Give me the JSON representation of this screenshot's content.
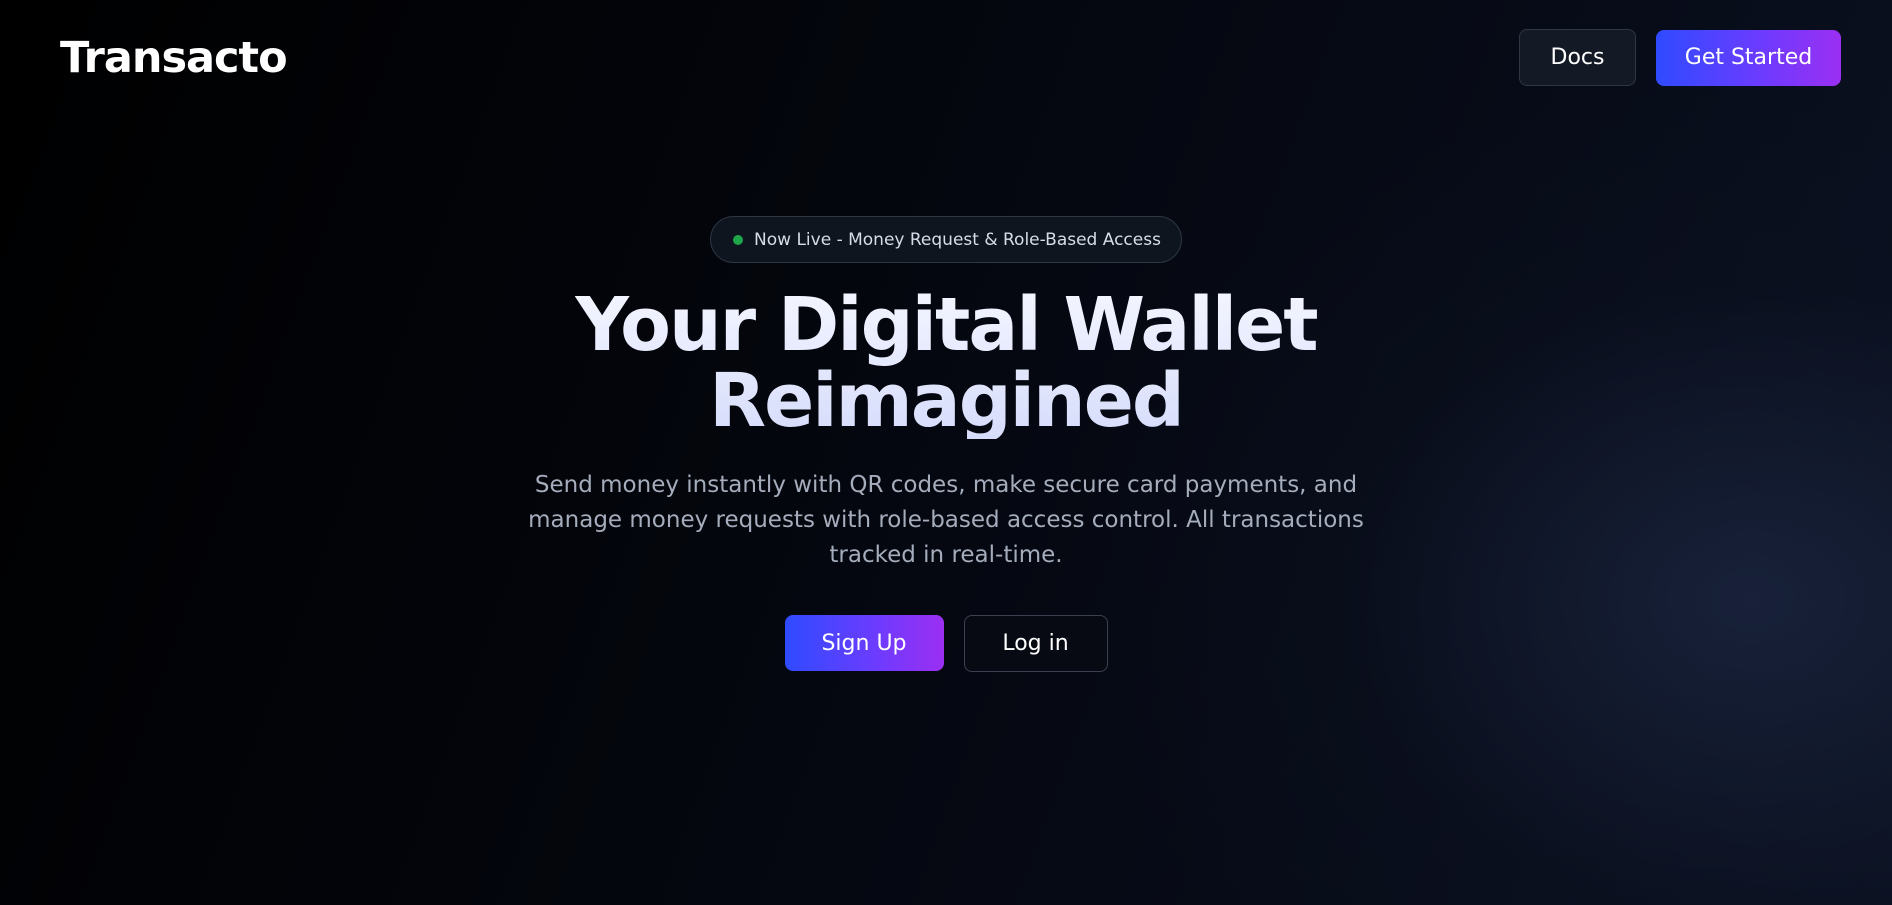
{
  "header": {
    "logo_text": "Transacto",
    "docs_label": "Docs",
    "get_started_label": "Get Started"
  },
  "hero": {
    "badge_text": "Now Live - Money Request & Role-Based Access",
    "headline_line1": "Your Digital Wallet",
    "headline_line2": "Reimagined",
    "subtext": "Send money instantly with QR codes, make secure card payments, and manage money requests with role-based access control. All transactions tracked in real-time.",
    "signup_label": "Sign Up",
    "login_label": "Log in"
  },
  "colors": {
    "accent_gradient_start": "#2f4bff",
    "accent_gradient_end": "#9b2ff2",
    "live_dot": "#1fa64a",
    "background": "#03050b"
  }
}
